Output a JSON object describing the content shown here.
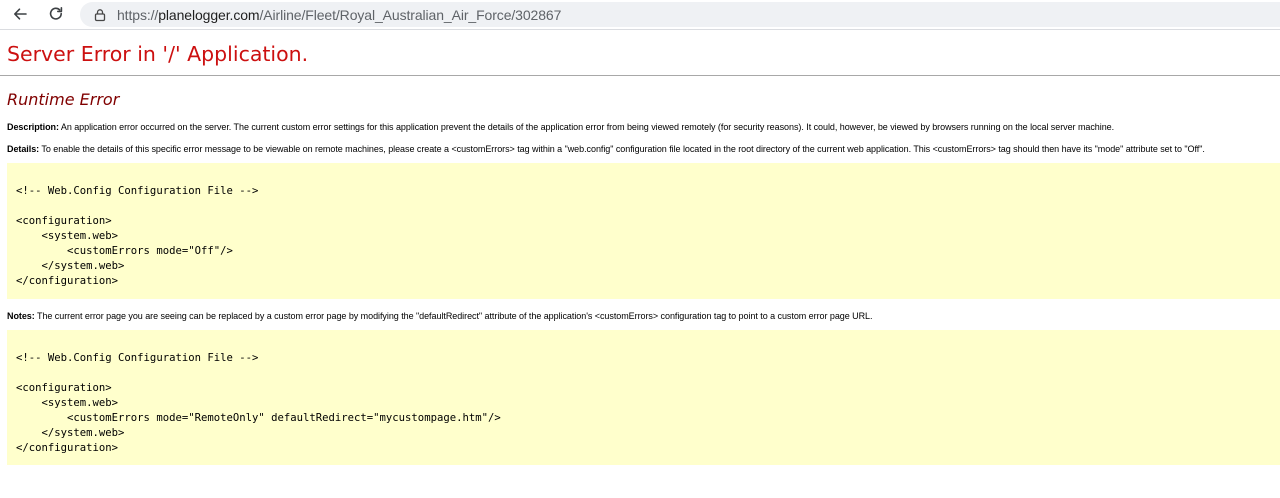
{
  "browser": {
    "url_prefix": "https://",
    "url_host": "planelogger.com",
    "url_path": "/Airline/Fleet/Royal_Australian_Air_Force/302867"
  },
  "page": {
    "title": "Server Error in '/' Application.",
    "subtitle": "Runtime Error",
    "description_label": "Description:",
    "description_text": " An application error occurred on the server. The current custom error settings for this application prevent the details of the application error from being viewed remotely (for security reasons). It could, however, be viewed by browsers running on the local server machine.",
    "details_label": "Details:",
    "details_text": " To enable the details of this specific error message to be viewable on remote machines, please create a <customErrors> tag within a \"web.config\" configuration file located in the root directory of the current web application. This <customErrors> tag should then have its \"mode\" attribute set to \"Off\".",
    "code1": "<!-- Web.Config Configuration File -->\n\n<configuration>\n    <system.web>\n        <customErrors mode=\"Off\"/>\n    </system.web>\n</configuration>",
    "notes_label": "Notes:",
    "notes_text": " The current error page you are seeing can be replaced by a custom error page by modifying the \"defaultRedirect\" attribute of the application's <customErrors> configuration tag to point to a custom error page URL.",
    "code2": "<!-- Web.Config Configuration File -->\n\n<configuration>\n    <system.web>\n        <customErrors mode=\"RemoteOnly\" defaultRedirect=\"mycustompage.htm\"/>\n    </system.web>\n</configuration>"
  },
  "colors": {
    "title": "#cc1010",
    "subtitle": "#800000",
    "code_background": "#ffffcc"
  },
  "icons": {
    "back": "arrow-left-icon",
    "reload": "reload-icon",
    "site_info": "site-info-icon"
  }
}
